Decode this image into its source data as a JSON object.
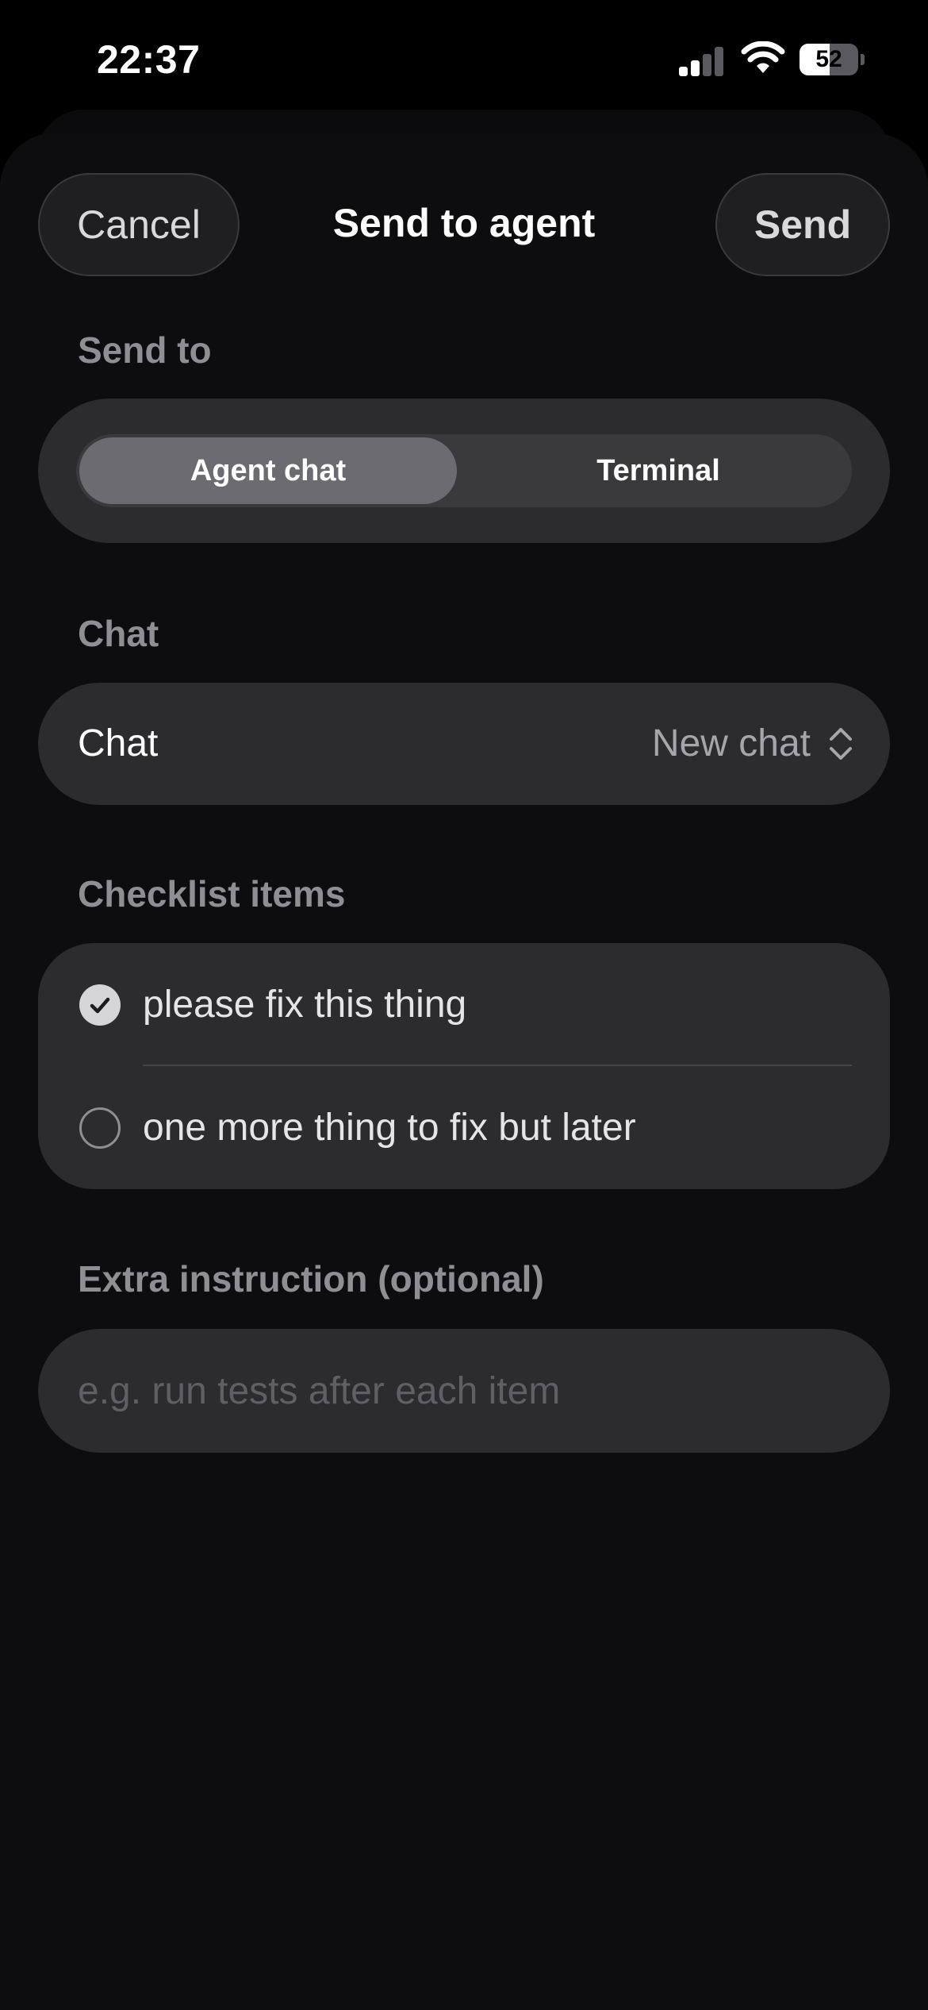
{
  "status_bar": {
    "time": "22:37",
    "battery_level": "52",
    "battery_fraction": 0.52,
    "signal_bars_active": 2,
    "signal_bars_total": 4
  },
  "header": {
    "cancel_label": "Cancel",
    "title": "Send to agent",
    "send_label": "Send"
  },
  "send_to": {
    "label": "Send to",
    "options": [
      "Agent chat",
      "Terminal"
    ],
    "selected": "Agent chat"
  },
  "chat": {
    "section_label": "Chat",
    "row_label": "Chat",
    "value": "New chat"
  },
  "checklist": {
    "section_label": "Checklist items",
    "items": [
      {
        "text": "please fix this thing",
        "checked": true
      },
      {
        "text": "one more thing to fix but later",
        "checked": false
      }
    ]
  },
  "extra_instruction": {
    "label": "Extra instruction (optional)",
    "value": "",
    "placeholder": "e.g. run tests after each item"
  },
  "colors": {
    "background": "#000000",
    "sheet": "#0d0d0f",
    "card": "#2c2c2e",
    "segment_selected": "#6b6b70",
    "secondary_text": "#8e8e93"
  }
}
